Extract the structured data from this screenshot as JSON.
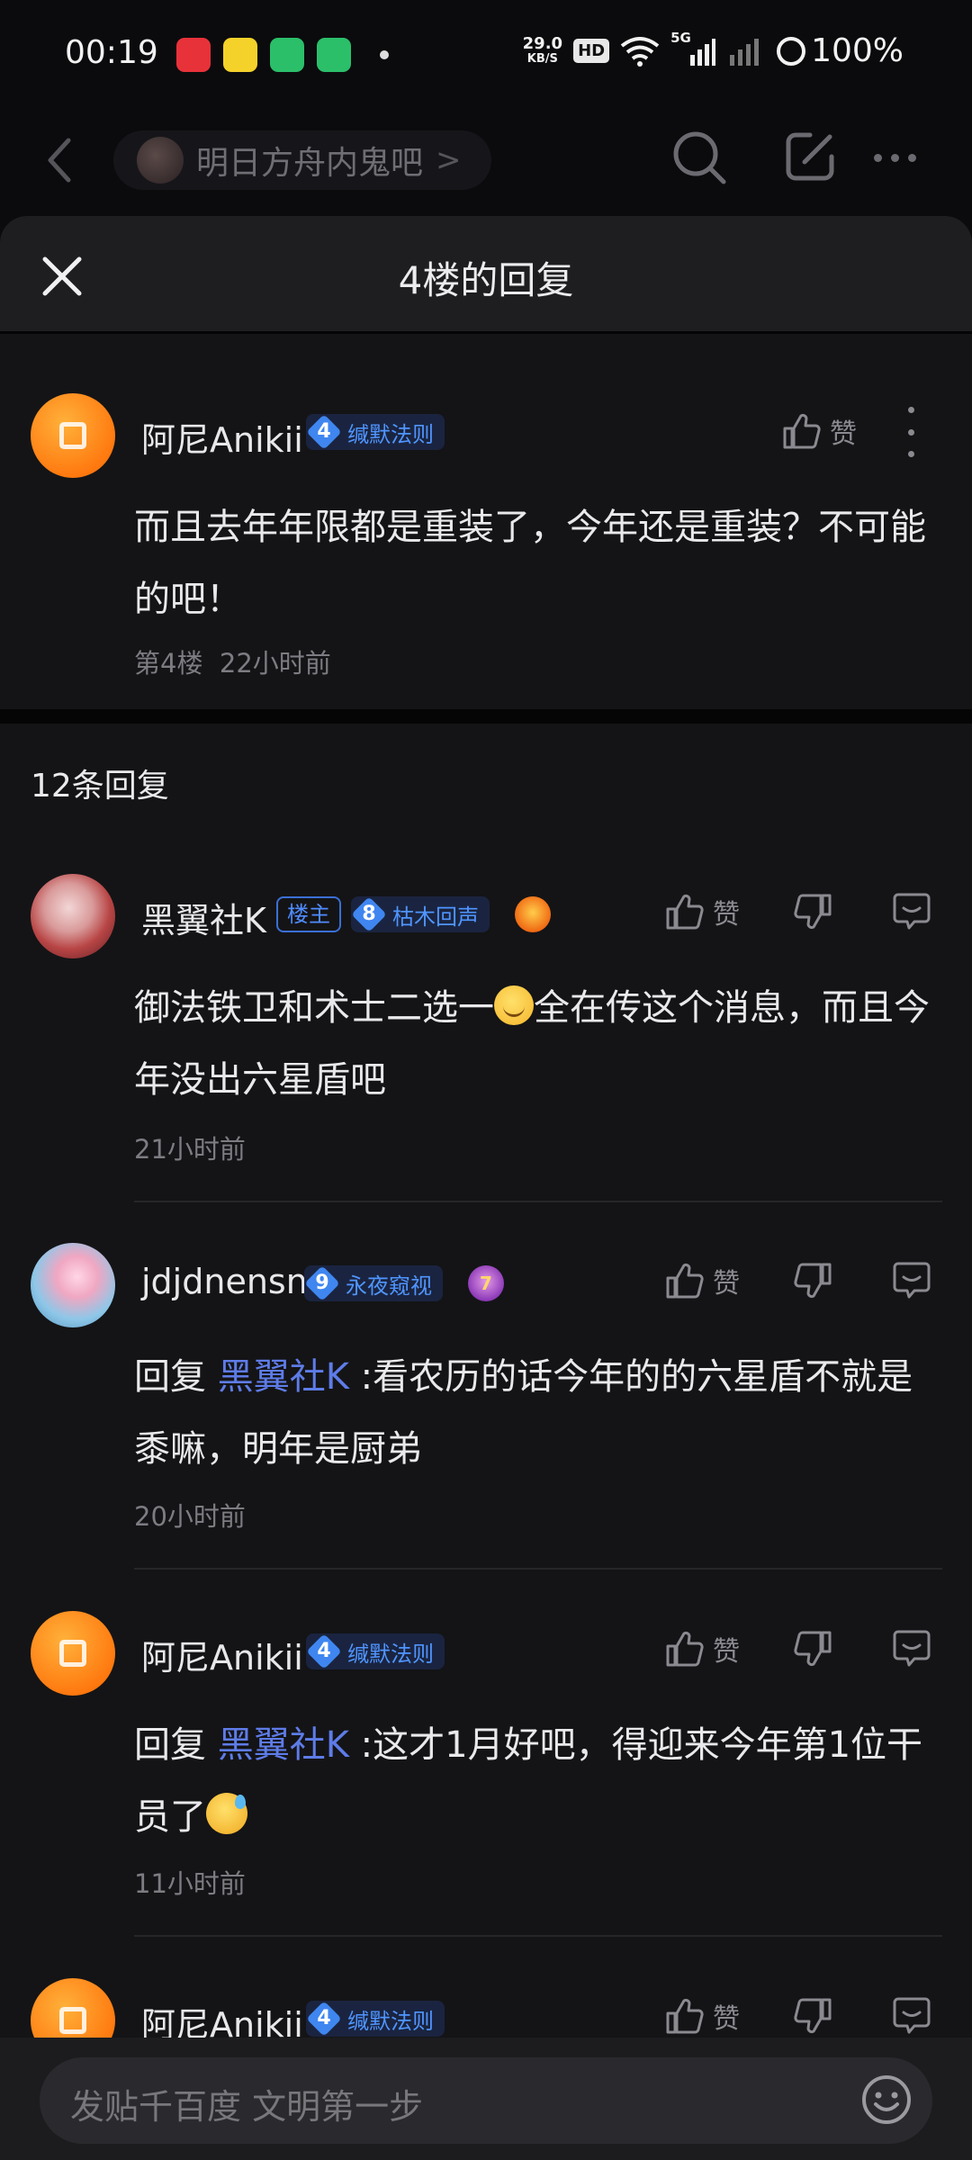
{
  "status_bar": {
    "time": "00:19",
    "app_icons": [
      "拼多多",
      "QQ音乐",
      "电池",
      "电池"
    ],
    "net_speed_value": "29.0",
    "net_speed_unit": "KB/S",
    "hd": "HD",
    "signal_label": "5G",
    "battery": "100%"
  },
  "nav": {
    "forum_name": "明日方舟内鬼吧",
    "chevron": ">"
  },
  "sheet": {
    "title": "4楼的回复"
  },
  "main_post": {
    "username": "阿尼Anikii",
    "level": "4",
    "level_title": "缄默法则",
    "like_label": "赞",
    "text": "而且去年年限都是重装了，今年还是重装？不可能的吧！",
    "floor": "第4楼",
    "time": "22小时前"
  },
  "reply_count": "12条回复",
  "replies": [
    {
      "username": "黑翼社K",
      "owner_badge": "楼主",
      "level": "8",
      "level_title": "枯木回声",
      "like_label": "赞",
      "text_before_emoji": "御法铁卫和术士二选一",
      "text_after_emoji": "全在传这个消息，而且今年没出六星盾吧",
      "time": "21小时前"
    },
    {
      "username": "jdjdnensn",
      "level": "9",
      "level_title": "永夜窥视",
      "emblem_text": "7",
      "like_label": "赞",
      "reply_prefix": "回复",
      "mention": "黑翼社K",
      "text": " :看农历的话今年的的六星盾不就是黍嘛，明年是厨弟",
      "time": "20小时前"
    },
    {
      "username": "阿尼Anikii",
      "level": "4",
      "level_title": "缄默法则",
      "like_label": "赞",
      "reply_prefix": "回复",
      "mention": "黑翼社K",
      "text": " :这才1月好吧，得迎来今年第1位干员了",
      "time": "11小时前"
    },
    {
      "username": "阿尼Anikii",
      "level": "4",
      "level_title": "缄默法则",
      "like_label": "赞"
    }
  ],
  "input": {
    "placeholder": "发贴千百度 文明第一步"
  },
  "colors": {
    "accent_blue": "#4f95ff",
    "mention": "#5e7ce8",
    "avatar_orange": "#ff7a10"
  }
}
